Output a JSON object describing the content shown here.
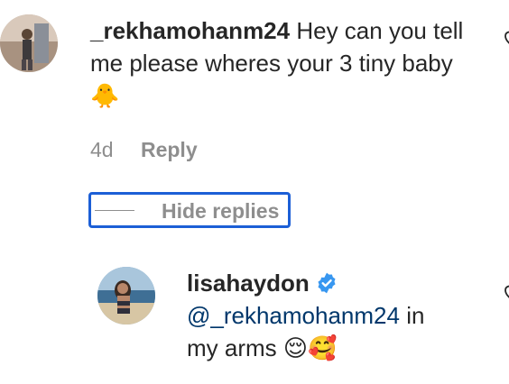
{
  "comments": [
    {
      "username": "_rekhamohanm24",
      "text": "Hey can you tell me please wheres your 3 tiny baby",
      "emoji": "🐥",
      "time": "4d",
      "reply_label": "Reply",
      "hide_replies_label": "Hide replies"
    }
  ],
  "replies": [
    {
      "username": "lisahaydon",
      "verified": true,
      "mention": "@_rekhamohanm24",
      "text_part1": "in",
      "text_part2": "my arms",
      "emojis": "😌🥰"
    }
  ],
  "colors": {
    "text": "#262626",
    "secondary": "#8e8e8e",
    "mention": "#00376b",
    "verified_badge": "#3897f0",
    "focus_outline": "#1c5fd6"
  },
  "icons": [
    "heart-icon",
    "verified-badge-icon",
    "avatar"
  ]
}
